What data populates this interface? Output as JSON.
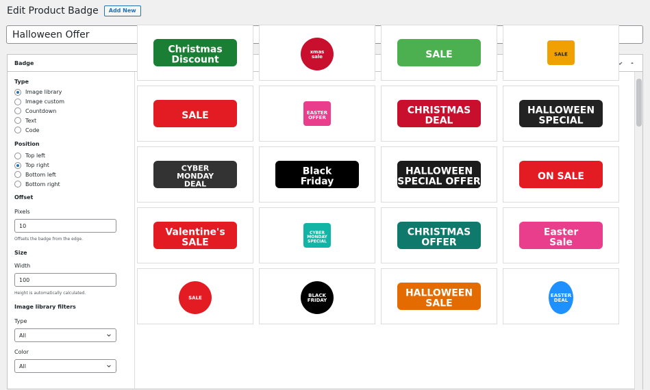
{
  "header": {
    "title": "Edit Product Badge",
    "add_new": "Add New"
  },
  "post": {
    "title": "Halloween Offer"
  },
  "panel": {
    "title": "Badge"
  },
  "sidebar": {
    "type_label": "Type",
    "type_options": [
      "Image library",
      "Image custom",
      "Countdown",
      "Text",
      "Code"
    ],
    "type_selected": "Image library",
    "position_label": "Position",
    "position_options": [
      "Top left",
      "Top right",
      "Bottom left",
      "Bottom right"
    ],
    "position_selected": "Top right",
    "offset_label": "Offset",
    "pixels_label": "Pixels",
    "pixels_value": "10",
    "offset_note": "Offsets the badge from the edge.",
    "size_label": "Size",
    "width_label": "Width",
    "width_value": "100",
    "size_note": "Height is automatically calculated.",
    "filters_label": "Image library filters",
    "filter_type_label": "Type",
    "filter_type_value": "All",
    "filter_color_label": "Color",
    "filter_color_value": "All"
  },
  "badges": [
    {
      "name": "badge-christmas-discount",
      "text": [
        "Christmas",
        "Discount"
      ],
      "color": "#1a7f34"
    },
    {
      "name": "badge-xmas-sale-ornament",
      "text": [
        "xmas",
        "sale"
      ],
      "color": "#c8102e"
    },
    {
      "name": "badge-sale-green-tag",
      "text": [
        "SALE"
      ],
      "color": "#4caf50"
    },
    {
      "name": "badge-sale-orange-tag",
      "text": [
        "SALE"
      ],
      "color": "#f0a000"
    },
    {
      "name": "badge-hearts-sale",
      "text": [
        "SALE"
      ],
      "color": "#e31b23"
    },
    {
      "name": "badge-easter-offer",
      "text": [
        "EASTER",
        "OFFER"
      ],
      "color": "#e83e8c"
    },
    {
      "name": "badge-christmas-deal",
      "text": [
        "CHRISTMAS",
        "DEAL"
      ],
      "color": "#c8102e"
    },
    {
      "name": "badge-halloween-special",
      "text": [
        "HALLOWEEN",
        "SPECIAL"
      ],
      "color": "#222222"
    },
    {
      "name": "badge-cyber-monday-deal",
      "text": [
        "CYBER",
        "MONDAY",
        "DEAL"
      ],
      "color": "#333333"
    },
    {
      "name": "badge-black-friday",
      "text": [
        "Black",
        "Friday"
      ],
      "color": "#000000"
    },
    {
      "name": "badge-halloween-special-offer",
      "text": [
        "HALLOWEEN",
        "SPECIAL OFFER"
      ],
      "color": "#1b1b1b"
    },
    {
      "name": "badge-on-sale-santa",
      "text": [
        "ON SALE"
      ],
      "color": "#e31b23"
    },
    {
      "name": "badge-valentines-sale",
      "text": [
        "Valentine's",
        "SALE"
      ],
      "color": "#e31b23"
    },
    {
      "name": "badge-cyber-monday-special",
      "text": [
        "CYBER",
        "MONDAY",
        "SPECIAL"
      ],
      "color": "#12b5a5"
    },
    {
      "name": "badge-christmas-offer",
      "text": [
        "CHRISTMAS",
        "OFFER"
      ],
      "color": "#0f7a6c"
    },
    {
      "name": "badge-easter-sale-bunny",
      "text": [
        "Easter",
        "Sale"
      ],
      "color": "#e83e8c"
    },
    {
      "name": "badge-sale-red-starburst",
      "text": [
        "SALE"
      ],
      "color": "#e31b23"
    },
    {
      "name": "badge-black-friday-starburst",
      "text": [
        "BLACK",
        "FRIDAY"
      ],
      "color": "#000000"
    },
    {
      "name": "badge-halloween-sale",
      "text": [
        "HALLOWEEN",
        "SALE"
      ],
      "color": "#e36b00"
    },
    {
      "name": "badge-easter-deal-egg",
      "text": [
        "EASTER",
        "DEAL"
      ],
      "color": "#1e90ff"
    }
  ]
}
